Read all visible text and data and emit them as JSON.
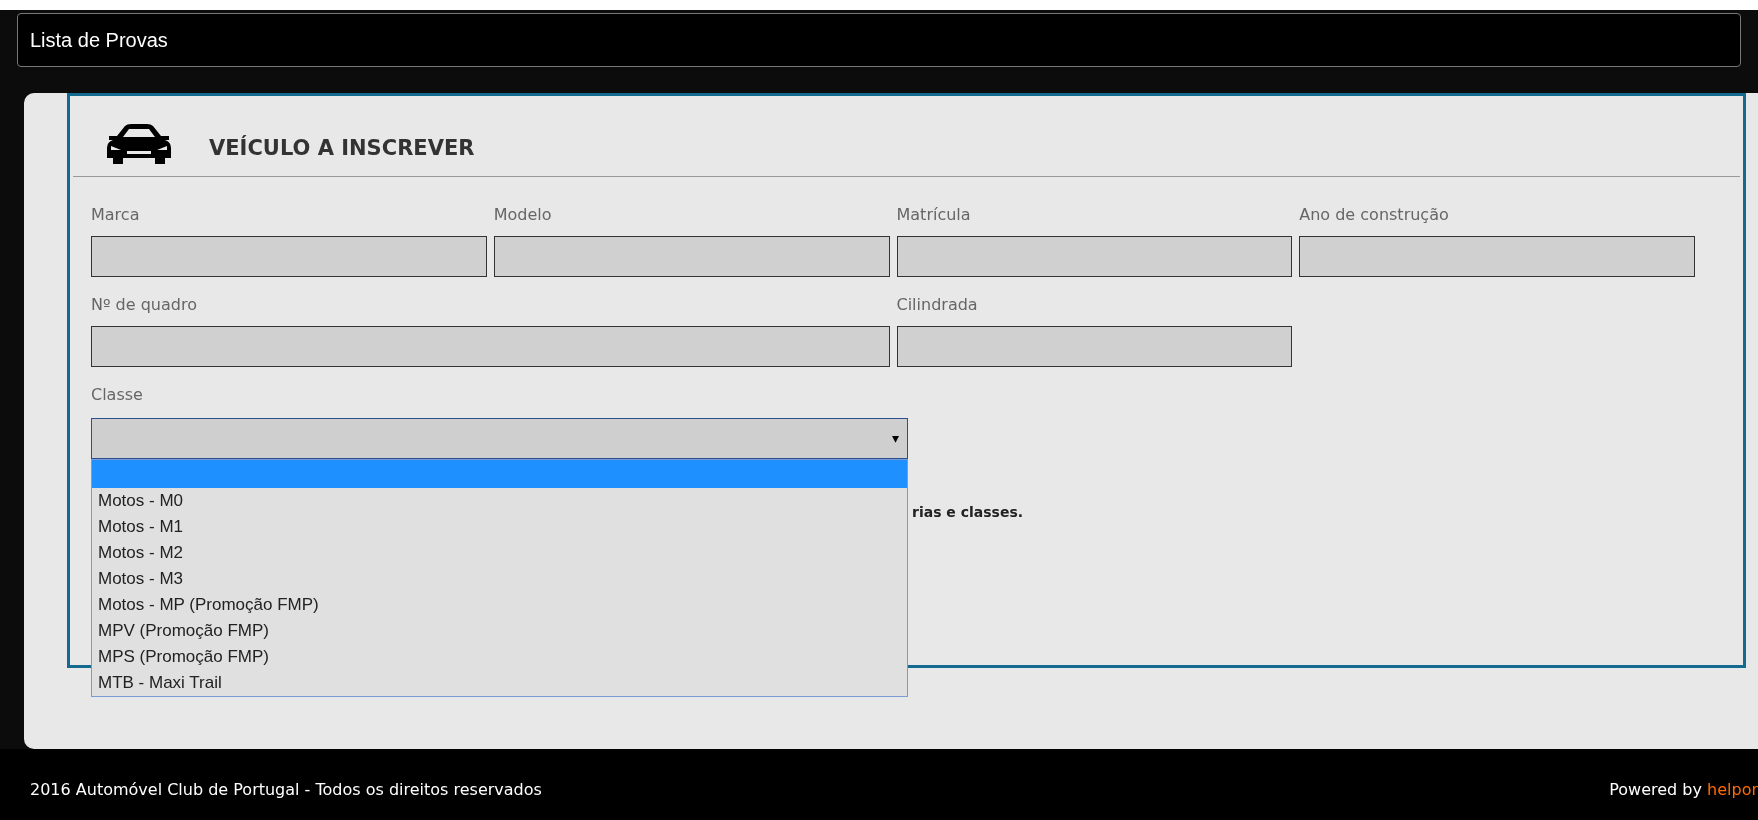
{
  "header": {
    "title": "Lista de Provas"
  },
  "section": {
    "title": "VEÍCULO A INSCREVER"
  },
  "fields": [
    {
      "label": "Marca",
      "kind": "normal"
    },
    {
      "label": "Modelo",
      "kind": "normal"
    },
    {
      "label": "Matrícula",
      "kind": "normal"
    },
    {
      "label": "Ano de construção",
      "kind": "normal"
    },
    {
      "label": "Nº de quadro",
      "kind": "wide"
    },
    {
      "label": "Cilindrada",
      "kind": "normal"
    }
  ],
  "classe": {
    "label": "Classe",
    "arrow": "▾",
    "expanded": true,
    "options": [
      {
        "selected": true
      },
      {
        "label": "Motos - M0",
        "selected": false
      },
      {
        "label": "Motos - M1",
        "selected": false
      },
      {
        "label": "Motos - M2",
        "selected": false
      },
      {
        "label": "Motos - M3",
        "selected": false
      },
      {
        "label": "Motos - MP (Promoção FMP)",
        "selected": false
      },
      {
        "label": "MPV (Promoção FMP)",
        "selected": false
      },
      {
        "label": "MPS (Promoção FMP)",
        "selected": false
      },
      {
        "label": "MTB - Maxi Trail",
        "selected": false
      }
    ]
  },
  "note": "rias e classes.",
  "footer": {
    "copyright": "2016 Automóvel Club de Portugal - Todos os direitos reservados",
    "powered_by": "Powered by",
    "brand": "helpor"
  }
}
